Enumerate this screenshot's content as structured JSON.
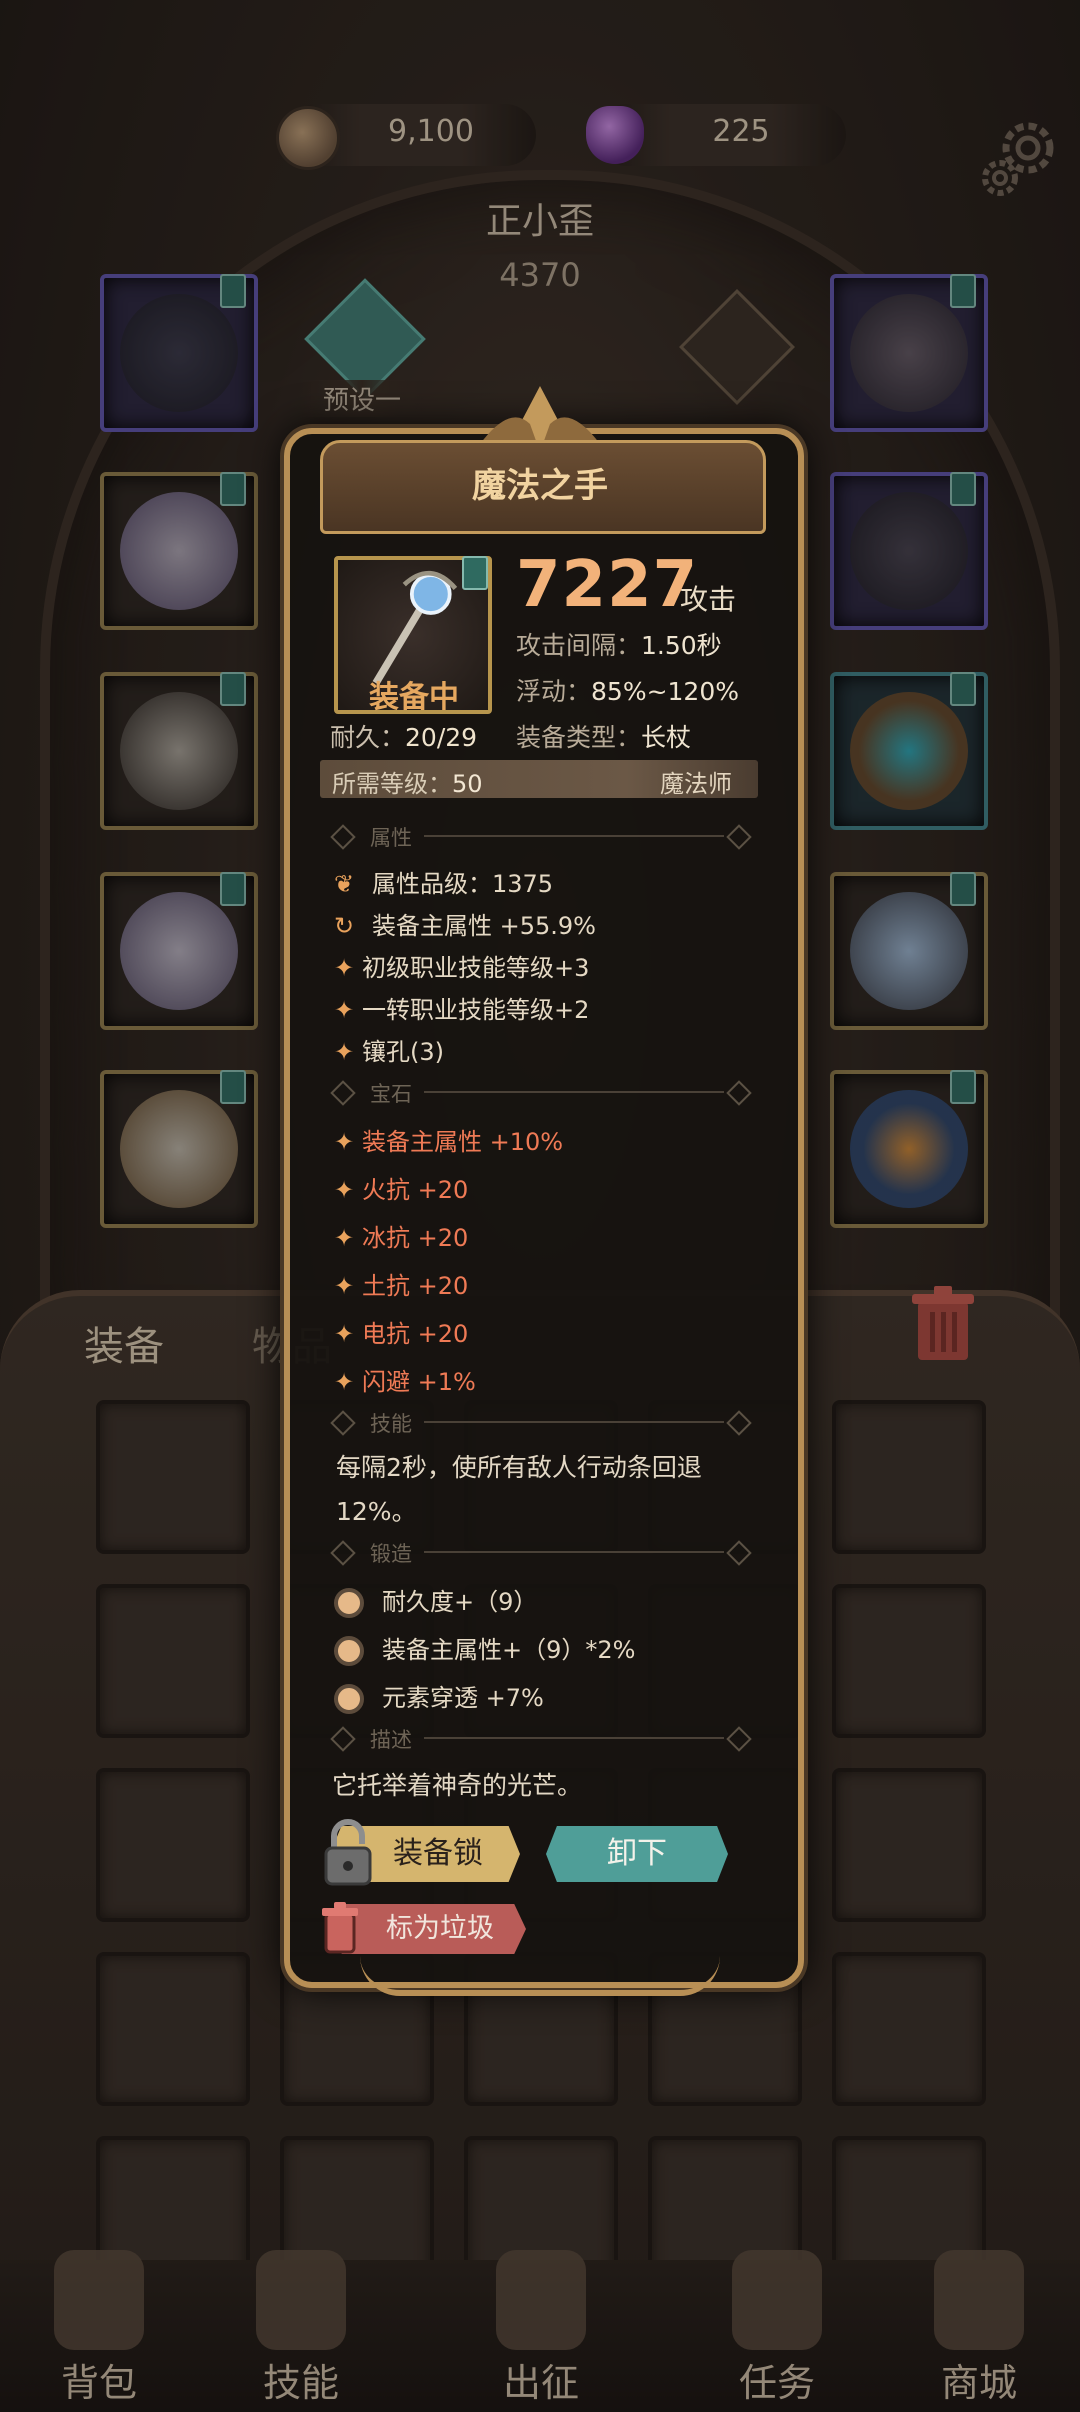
{
  "currency": {
    "coins": "9,100",
    "gems": "225"
  },
  "hero": {
    "name": "正小歪",
    "power": "4370",
    "preset_label": "预设一"
  },
  "tabs": {
    "equipment": "装备",
    "items": "物品"
  },
  "nav": [
    {
      "label": "背包",
      "icon": "backpack-icon"
    },
    {
      "label": "技能",
      "icon": "skill-book-icon"
    },
    {
      "label": "出征",
      "icon": "sword-scroll-icon"
    },
    {
      "label": "任务",
      "icon": "scroll-icon"
    },
    {
      "label": "商城",
      "icon": "crown-shop-icon"
    }
  ],
  "item": {
    "name": "魔法之手",
    "equipped_label": "装备中",
    "durability_label": "耐久：",
    "durability_value": "20/29",
    "attack_value": "7227",
    "attack_label": "攻击",
    "interval_label": "攻击间隔：",
    "interval_value": "1.50秒",
    "float_label": "浮动：",
    "float_value": "85%~120%",
    "type_label": "装备类型：",
    "type_value": "长杖",
    "req_label": "所需等级：",
    "req_value": "50",
    "class": "魔法师",
    "sections": {
      "attributes": "属性",
      "gems": "宝石",
      "skill": "技能",
      "forge": "锻造",
      "description": "描述"
    },
    "attributes": [
      "属性品级：1375",
      "装备主属性 +55.9%",
      "初级职业技能等级+3",
      "一转职业技能等级+2",
      "镶孔(3)"
    ],
    "gems": [
      "装备主属性 +10%",
      "火抗 +20",
      "冰抗 +20",
      "土抗 +20",
      "电抗 +20",
      "闪避 +1%"
    ],
    "skill_line1": "每隔2秒，使所有敌人行动条回退",
    "skill_line2": "12%。",
    "forge": [
      "耐久度+（9）",
      "装备主属性+（9）*2%",
      "元素穿透 +7%"
    ],
    "description": "它托举着神奇的光芒。",
    "buttons": {
      "lock": "装备锁",
      "unequip": "卸下",
      "mark_trash": "标为垃圾"
    }
  },
  "colors": {
    "accent_gold": "#b88f55",
    "gem_text": "#ef7a55",
    "attack_value": "#f2b27a",
    "unequip_button": "#4f9e98",
    "lock_button": "#d5b56e",
    "trash_button": "#b95c58"
  }
}
